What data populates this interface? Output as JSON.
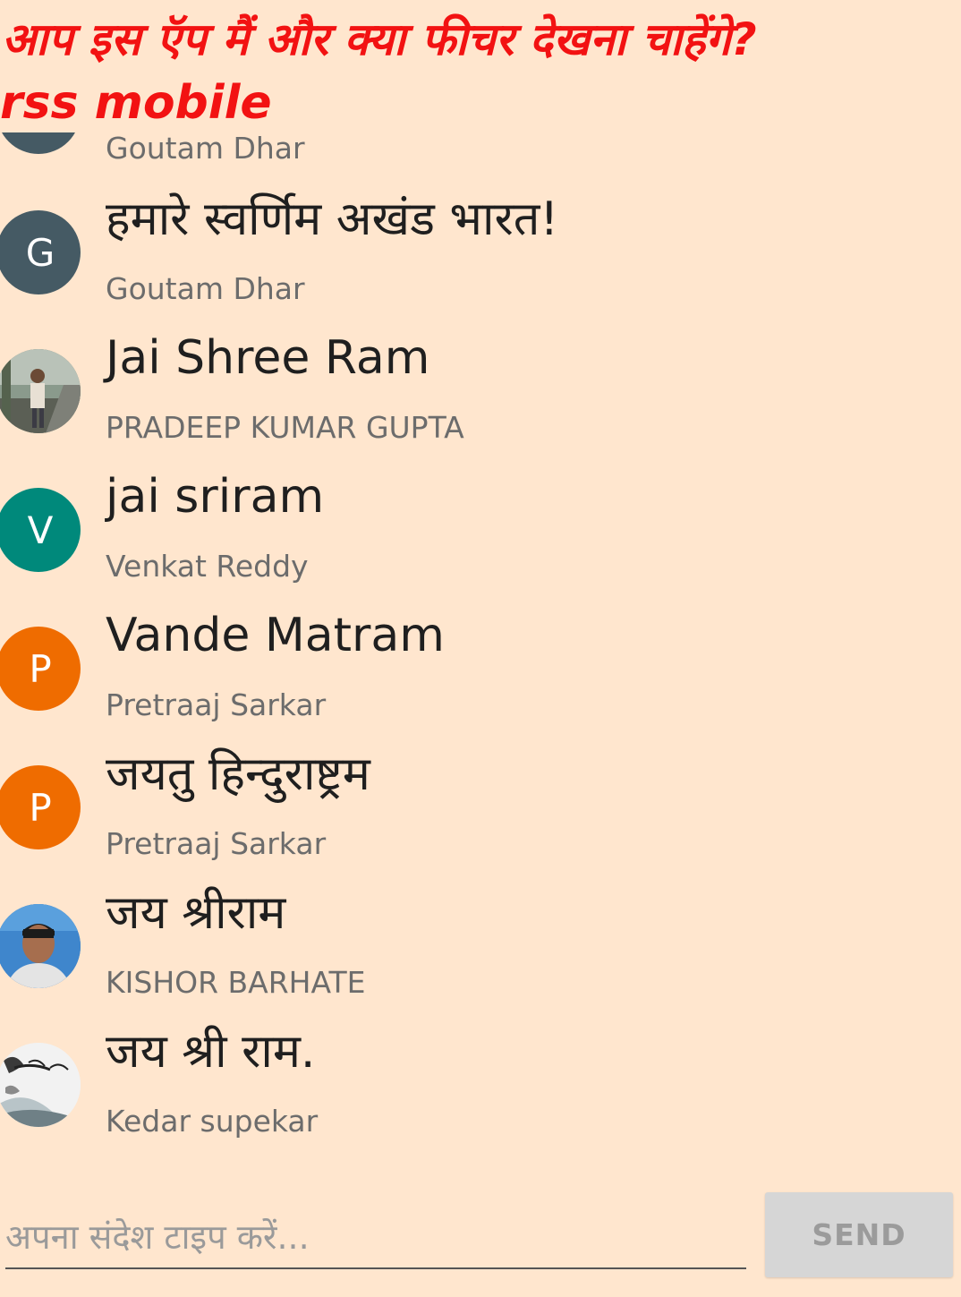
{
  "header": {
    "title": "आप इस ऍप मैं और क्या फीचर देखना चाहेंगे?",
    "subtitle": "rss mobile"
  },
  "messages": [
    {
      "text": "",
      "author": "Goutam Dhar",
      "avatar": {
        "type": "initial",
        "letter": "",
        "color": "#455A64"
      }
    },
    {
      "text": "हमारे स्वर्णिम अखंड भारत!",
      "author": "Goutam Dhar",
      "avatar": {
        "type": "initial",
        "letter": "G",
        "color": "#455A64"
      }
    },
    {
      "text": "Jai Shree Ram",
      "author": "PRADEEP KUMAR GUPTA",
      "avatar": {
        "type": "photo",
        "icon": "user-photo"
      }
    },
    {
      "text": "jai sriram",
      "author": "Venkat Reddy",
      "avatar": {
        "type": "initial",
        "letter": "V",
        "color": "#00897B"
      }
    },
    {
      "text": "Vande Matram",
      "author": "Pretraaj Sarkar",
      "avatar": {
        "type": "initial",
        "letter": "P",
        "color": "#EF6C00"
      }
    },
    {
      "text": "जयतु हिन्दुराष्ट्रम",
      "author": "Pretraaj Sarkar",
      "avatar": {
        "type": "initial",
        "letter": "P",
        "color": "#EF6C00"
      }
    },
    {
      "text": "जय श्रीराम",
      "author": "KISHOR BARHATE",
      "avatar": {
        "type": "photo",
        "icon": "user-photo"
      }
    },
    {
      "text": "जय श्री राम.",
      "author": "Kedar supekar",
      "avatar": {
        "type": "photo",
        "icon": "user-photo"
      }
    }
  ],
  "composer": {
    "placeholder": "अपना संदेश टाइप करें...",
    "value": "",
    "send_label": "SEND"
  },
  "colors": {
    "background": "#FFE6CE",
    "header_text": "#F21212",
    "author_text": "#6C6C6C",
    "send_button_bg": "#D6D6D6"
  }
}
